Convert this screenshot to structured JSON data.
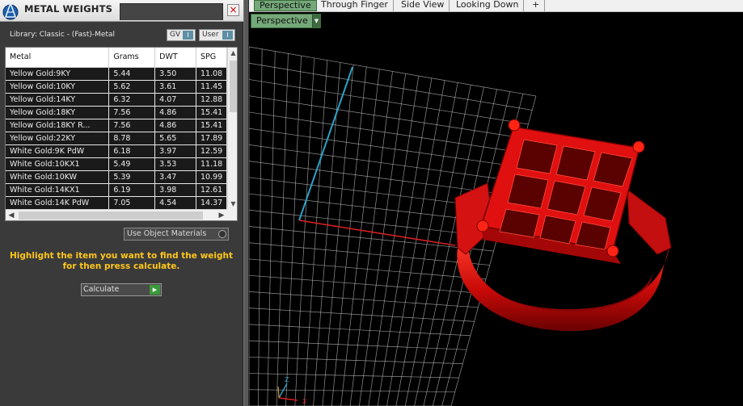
{
  "panel": {
    "title": "METAL WEIGHTS",
    "close": "×",
    "library_label": "Library: Classic - (Fast)-Metal",
    "toggles": [
      {
        "label": "GV",
        "button": "I"
      },
      {
        "label": "User",
        "button": "I"
      }
    ],
    "table": {
      "columns": [
        "Metal",
        "Grams",
        "DWT",
        "SPG"
      ],
      "rows": [
        [
          "Yellow Gold:9KY",
          "5.44",
          "3.50",
          "11.08"
        ],
        [
          "Yellow Gold:10KY",
          "5.62",
          "3.61",
          "11.45"
        ],
        [
          "Yellow Gold:14KY",
          "6.32",
          "4.07",
          "12.88"
        ],
        [
          "Yellow Gold:18KY",
          "7.56",
          "4.86",
          "15.41"
        ],
        [
          "Yellow Gold:18KY R...",
          "7.56",
          "4.86",
          "15.41"
        ],
        [
          "Yellow Gold:22KY",
          "8.78",
          "5.65",
          "17.89"
        ],
        [
          "White Gold:9K PdW",
          "6.18",
          "3.97",
          "12.59"
        ],
        [
          "White Gold:10KX1",
          "5.49",
          "3.53",
          "11.18"
        ],
        [
          "White Gold:10KW",
          "5.39",
          "3.47",
          "10.99"
        ],
        [
          "White Gold:14KX1",
          "6.19",
          "3.98",
          "12.61"
        ],
        [
          "White Gold:14K PdW",
          "7.05",
          "4.54",
          "14.37"
        ]
      ]
    },
    "use_object_materials": "Use Object Materials",
    "hint": "Highlight the item you want to find the weight for then press calculate.",
    "calculate": "Calculate"
  },
  "viewport": {
    "tabs": [
      "Perspective",
      "Through Finger",
      "Side View",
      "Looking Down",
      "+"
    ],
    "active_tab": "Perspective",
    "view_dropdown": "Perspective",
    "axis_labels": {
      "z": "Z",
      "x": "X"
    },
    "colors": {
      "model": "#e01010",
      "grid": "#bfbfbf",
      "x_axis": "#d42020",
      "y_axis": "#2aa3c8",
      "tab_active": "#74a878",
      "hint": "#ffc61a"
    }
  }
}
